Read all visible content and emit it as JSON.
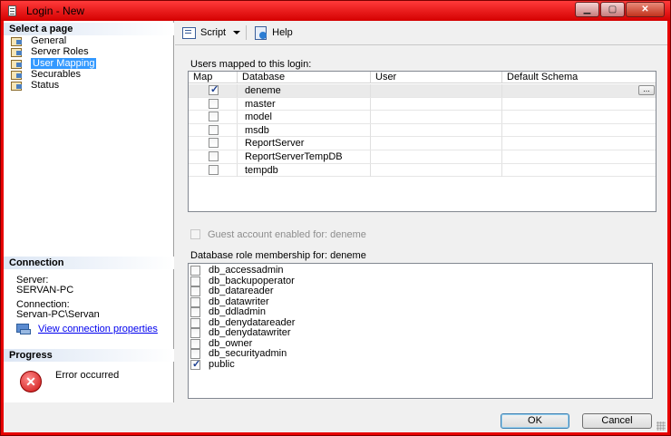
{
  "window": {
    "title": "Login - New"
  },
  "sidebar": {
    "select_page_heading": "Select a page",
    "pages": [
      {
        "label": "General",
        "selected": false
      },
      {
        "label": "Server Roles",
        "selected": false
      },
      {
        "label": "User Mapping",
        "selected": true
      },
      {
        "label": "Securables",
        "selected": false
      },
      {
        "label": "Status",
        "selected": false
      }
    ],
    "connection_heading": "Connection",
    "server_label": "Server:",
    "server_value": "SERVAN-PC",
    "connection_label": "Connection:",
    "connection_value": "Servan-PC\\Servan",
    "view_connection_link": "View connection properties",
    "progress_heading": "Progress",
    "progress_status": "Error occurred"
  },
  "toolbar": {
    "script_label": "Script",
    "help_label": "Help"
  },
  "users_mapped": {
    "label": "Users mapped to this login:",
    "columns": [
      "Map",
      "Database",
      "User",
      "Default Schema"
    ],
    "rows": [
      {
        "checked": true,
        "database": "deneme",
        "user": "",
        "schema": "",
        "has_browse": true,
        "browse_label": "..."
      },
      {
        "checked": false,
        "database": "master",
        "user": "",
        "schema": ""
      },
      {
        "checked": false,
        "database": "model",
        "user": "",
        "schema": ""
      },
      {
        "checked": false,
        "database": "msdb",
        "user": "",
        "schema": ""
      },
      {
        "checked": false,
        "database": "ReportServer",
        "user": "",
        "schema": ""
      },
      {
        "checked": false,
        "database": "ReportServerTempDB",
        "user": "",
        "schema": ""
      },
      {
        "checked": false,
        "database": "tempdb",
        "user": "",
        "schema": ""
      }
    ]
  },
  "guest": {
    "label": "Guest account enabled for: deneme",
    "checked": false,
    "enabled": false
  },
  "roles": {
    "label": "Database role membership for: deneme",
    "items": [
      {
        "name": "db_accessadmin",
        "checked": false
      },
      {
        "name": "db_backupoperator",
        "checked": false
      },
      {
        "name": "db_datareader",
        "checked": false
      },
      {
        "name": "db_datawriter",
        "checked": false
      },
      {
        "name": "db_ddladmin",
        "checked": false
      },
      {
        "name": "db_denydatareader",
        "checked": false
      },
      {
        "name": "db_denydatawriter",
        "checked": false
      },
      {
        "name": "db_owner",
        "checked": false
      },
      {
        "name": "db_securityadmin",
        "checked": false
      },
      {
        "name": "public",
        "checked": true
      }
    ]
  },
  "buttons": {
    "ok_label": "OK",
    "cancel_label": "Cancel"
  },
  "colors": {
    "window_frame": "#e60000",
    "selection": "#3399ff",
    "link": "#0000ee"
  }
}
